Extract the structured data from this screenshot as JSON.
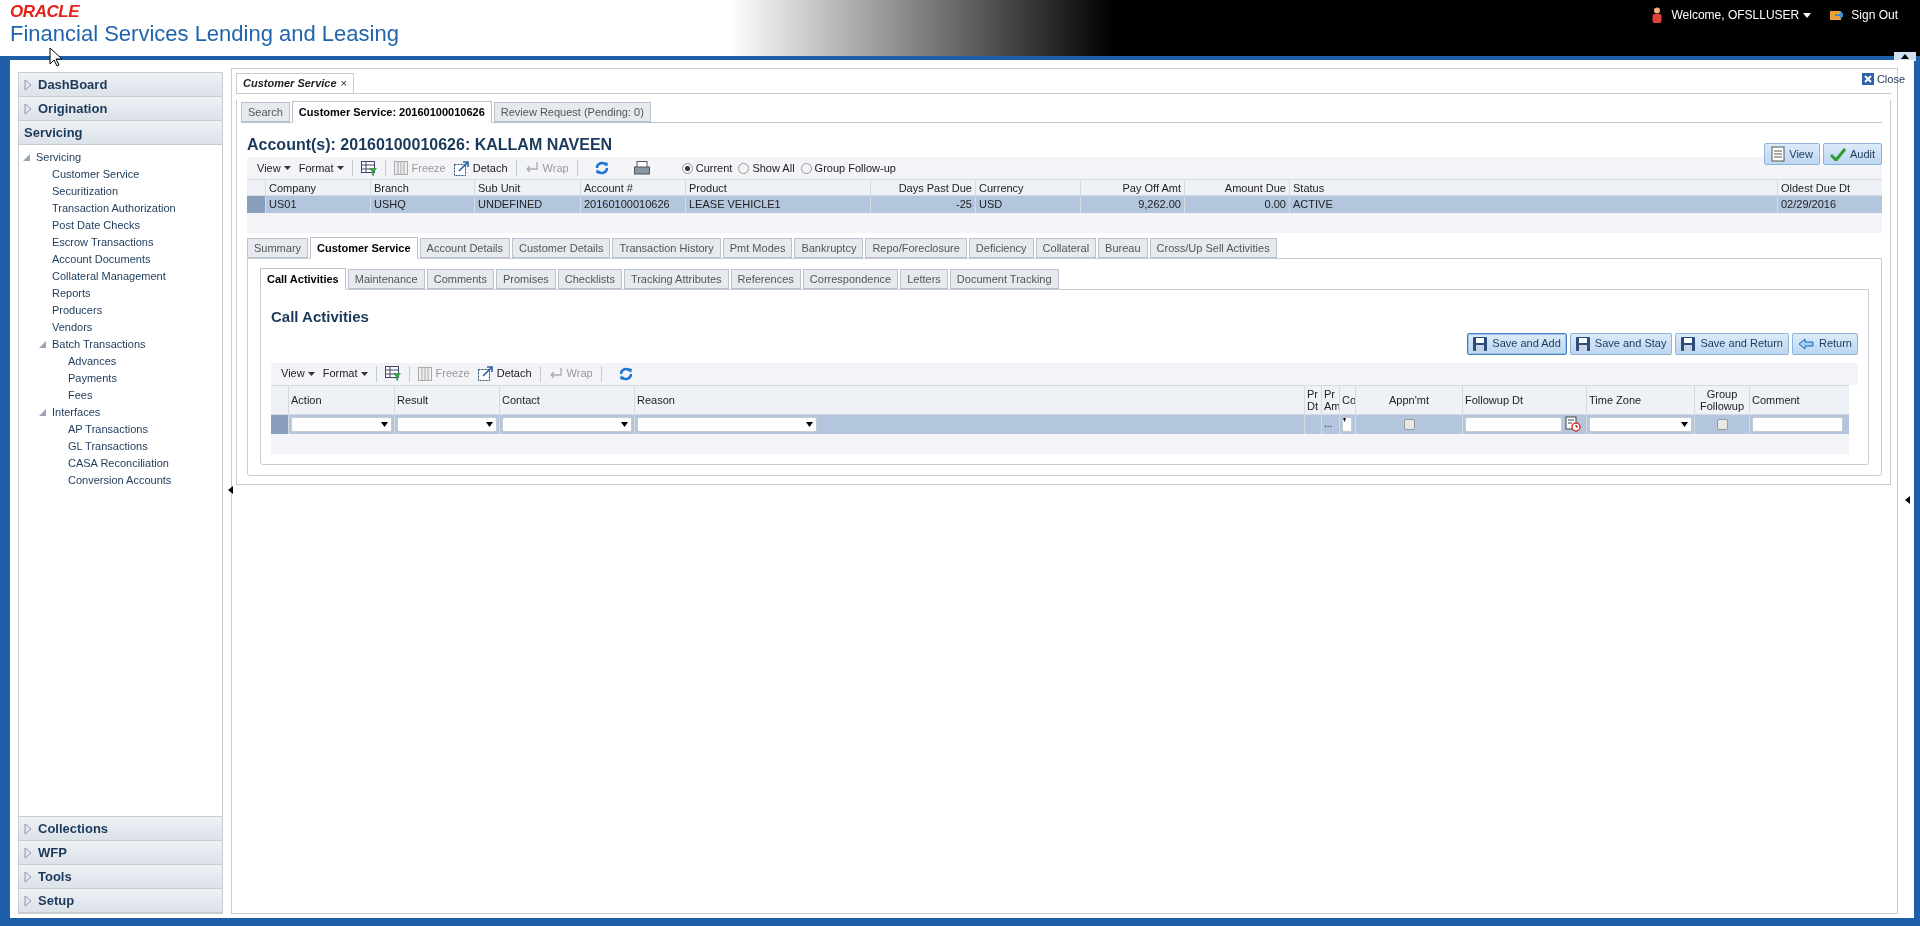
{
  "header": {
    "logo": "ORACLE",
    "title": "Financial Services Lending and Leasing",
    "user": "Welcome, OFSLLUSER",
    "sign_out": "Sign Out"
  },
  "sidebar": {
    "top_sections": [
      {
        "label": "DashBoard",
        "expanded": false
      },
      {
        "label": "Origination",
        "expanded": false
      },
      {
        "label": "Servicing",
        "expanded": true
      }
    ],
    "tree": [
      {
        "label": "Servicing",
        "children": [
          {
            "label": "Customer Service"
          },
          {
            "label": "Securitization"
          },
          {
            "label": "Transaction Authorization"
          },
          {
            "label": "Post Date Checks"
          },
          {
            "label": "Escrow Transactions"
          },
          {
            "label": "Account Documents"
          },
          {
            "label": "Collateral Management"
          },
          {
            "label": "Reports"
          },
          {
            "label": "Producers"
          },
          {
            "label": "Vendors"
          },
          {
            "label": "Batch Transactions",
            "children": [
              {
                "label": "Advances"
              },
              {
                "label": "Payments"
              },
              {
                "label": "Fees"
              }
            ]
          },
          {
            "label": "Interfaces",
            "children": [
              {
                "label": "AP Transactions"
              },
              {
                "label": "GL Transactions"
              },
              {
                "label": "CASA Reconciliation"
              },
              {
                "label": "Conversion Accounts"
              }
            ]
          }
        ]
      }
    ],
    "bottom_sections": [
      {
        "label": "Collections",
        "expanded": false
      },
      {
        "label": "WFP",
        "expanded": false
      },
      {
        "label": "Tools",
        "expanded": false
      },
      {
        "label": "Setup",
        "expanded": false
      }
    ]
  },
  "page_tab": {
    "label": "Customer Service",
    "close": "×"
  },
  "close_link": "Close",
  "sub_tabs": [
    {
      "label": "Search",
      "selected": false
    },
    {
      "label": "Customer Service: 20160100010626",
      "selected": true
    },
    {
      "label": "Review Request (Pending: 0)",
      "selected": false
    }
  ],
  "account_title": "Account(s): 20160100010626: KALLAM NAVEEN",
  "account_buttons": [
    {
      "label": "View",
      "kind": "view"
    },
    {
      "label": "Audit",
      "kind": "audit"
    }
  ],
  "account_toolbar": {
    "menus": [
      "View",
      "Format"
    ],
    "freeze": {
      "label": "Freeze",
      "disabled": true
    },
    "detach": {
      "label": "Detach",
      "disabled": false
    },
    "wrap": {
      "label": "Wrap",
      "disabled": true
    },
    "radios": [
      {
        "label": "Current",
        "selected": true
      },
      {
        "label": "Show All",
        "selected": false
      },
      {
        "label": "Group Follow-up",
        "selected": false
      }
    ]
  },
  "account_table": {
    "columns": [
      {
        "label": "Company",
        "kind": "text"
      },
      {
        "label": "Branch",
        "kind": "text"
      },
      {
        "label": "Sub Unit",
        "kind": "text"
      },
      {
        "label": "Account #",
        "kind": "text"
      },
      {
        "label": "Product",
        "kind": "text"
      },
      {
        "label": "Days Past Due",
        "kind": "number"
      },
      {
        "label": "Currency",
        "kind": "text"
      },
      {
        "label": "Pay Off Amt",
        "kind": "number"
      },
      {
        "label": "Amount Due",
        "kind": "number"
      },
      {
        "label": "Status",
        "kind": "text"
      },
      {
        "label": "Oldest Due Dt",
        "kind": "text"
      }
    ],
    "rows": [
      {
        "selected": true,
        "cells": [
          "US01",
          "USHQ",
          "UNDEFINED",
          "20160100010626",
          "LEASE VEHICLE1",
          "-25",
          "USD",
          "9,262.00",
          "0.00",
          "ACTIVE",
          "02/29/2016"
        ]
      }
    ]
  },
  "section_tabs": [
    {
      "label": "Summary",
      "selected": false
    },
    {
      "label": "Customer Service",
      "selected": true
    },
    {
      "label": "Account Details",
      "selected": false
    },
    {
      "label": "Customer Details",
      "selected": false
    },
    {
      "label": "Transaction History",
      "selected": false
    },
    {
      "label": "Pmt Modes",
      "selected": false
    },
    {
      "label": "Bankruptcy",
      "selected": false
    },
    {
      "label": "Repo/Foreclosure",
      "selected": false
    },
    {
      "label": "Deficiency",
      "selected": false
    },
    {
      "label": "Collateral",
      "selected": false
    },
    {
      "label": "Bureau",
      "selected": false
    },
    {
      "label": "Cross/Up Sell Activities",
      "selected": false
    }
  ],
  "inner_tabs": [
    {
      "label": "Call Activities",
      "selected": true
    },
    {
      "label": "Maintenance",
      "selected": false
    },
    {
      "label": "Comments",
      "selected": false
    },
    {
      "label": "Promises",
      "selected": false
    },
    {
      "label": "Checklists",
      "selected": false
    },
    {
      "label": "Tracking Attributes",
      "selected": false
    },
    {
      "label": "References",
      "selected": false
    },
    {
      "label": "Correspondence",
      "selected": false
    },
    {
      "label": "Letters",
      "selected": false
    },
    {
      "label": "Document Tracking",
      "selected": false
    }
  ],
  "call_activities": {
    "title": "Call Activities",
    "buttons": [
      {
        "label": "Save and Add",
        "kind": "save",
        "focused": true
      },
      {
        "label": "Save and Stay",
        "kind": "save",
        "focused": false
      },
      {
        "label": "Save and Return",
        "kind": "save",
        "focused": false
      },
      {
        "label": "Return",
        "kind": "return",
        "focused": false
      }
    ],
    "toolbar": {
      "menus": [
        "View",
        "Format"
      ],
      "freeze": {
        "label": "Freeze",
        "disabled": true
      },
      "detach": {
        "label": "Detach",
        "disabled": false
      },
      "wrap": {
        "label": "Wrap",
        "disabled": true
      }
    },
    "columns": [
      {
        "label": "Action",
        "kind": "select"
      },
      {
        "label": "Result",
        "kind": "select"
      },
      {
        "label": "Contact",
        "kind": "select"
      },
      {
        "label": "Reason",
        "kind": "select"
      },
      {
        "label": "Pr\nDt",
        "kind": "empty"
      },
      {
        "label": "Pr\nAm",
        "kind": "ellipsis",
        "value": "..."
      },
      {
        "label": "Co",
        "kind": "mini_select"
      },
      {
        "label": "Appn'mt",
        "kind": "checkbox",
        "checked": false
      },
      {
        "label": "Followup Dt",
        "kind": "date"
      },
      {
        "label": "Time Zone",
        "kind": "select"
      },
      {
        "label": "Group\nFollowup",
        "kind": "checkbox",
        "checked": false
      },
      {
        "label": "Comment",
        "kind": "text"
      }
    ]
  }
}
